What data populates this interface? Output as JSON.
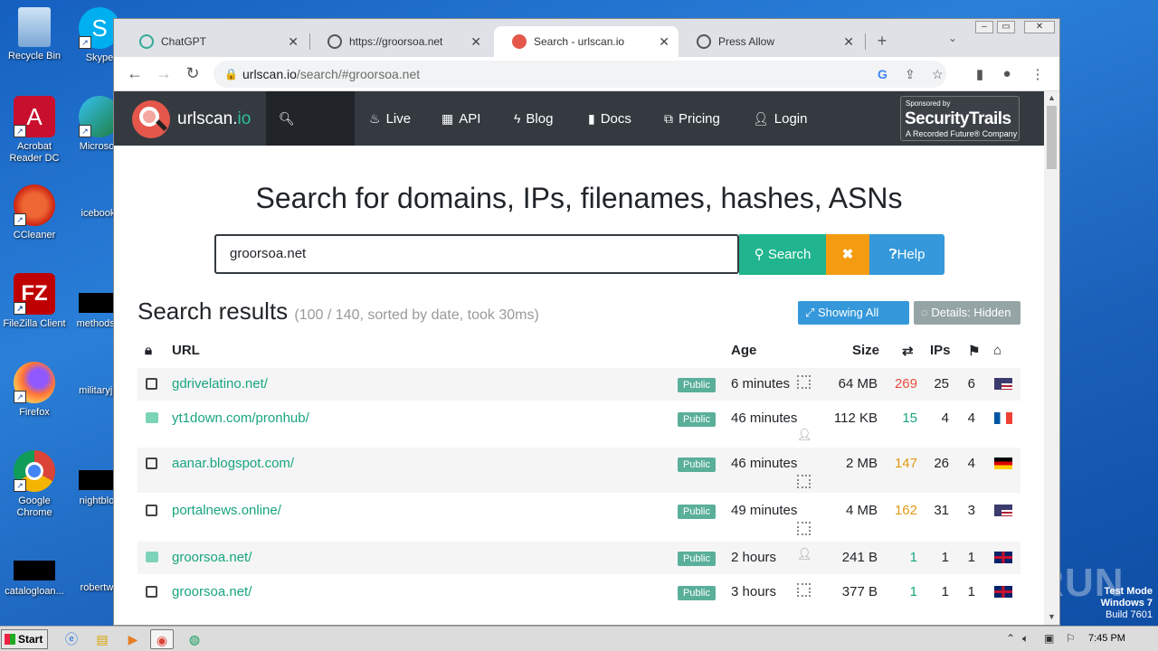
{
  "desktop": {
    "icons": [
      {
        "label": "Recycle Bin"
      },
      {
        "label": "Acrobat Reader DC"
      },
      {
        "label": "CCleaner"
      },
      {
        "label": "FileZilla Client"
      },
      {
        "label": "Firefox"
      },
      {
        "label": "Google Chrome"
      },
      {
        "label": "catalogloan..."
      },
      {
        "label": "Skype"
      },
      {
        "label": "Microsoft"
      },
      {
        "label": "icebook."
      },
      {
        "label": "methodsla"
      },
      {
        "label": "militaryjul"
      },
      {
        "label": "nightblog"
      },
      {
        "label": "robertwo"
      }
    ],
    "watermark": "ANY.RUN",
    "os_info": {
      "line1": "Test Mode",
      "line2": "Windows 7",
      "line3": "Build 7601"
    }
  },
  "browser": {
    "tabs": [
      {
        "title": "ChatGPT",
        "icon": "chatgpt-icon"
      },
      {
        "title": "https://groorsoa.net",
        "icon": "globe-icon"
      },
      {
        "title": "Search - urlscan.io",
        "icon": "urlscan-icon",
        "active": true
      },
      {
        "title": "Press Allow",
        "icon": "globe-icon"
      }
    ],
    "url_host": "urlscan.io",
    "url_path": "/search/#groorsoa.net"
  },
  "site": {
    "brand_name": "urlscan.",
    "brand_suffix": "io",
    "nav": [
      {
        "label": "Search",
        "icon": "search-icon"
      },
      {
        "label": "Live",
        "icon": "fire-icon"
      },
      {
        "label": "API",
        "icon": "qrcode-icon"
      },
      {
        "label": "Blog",
        "icon": "bolt-icon"
      },
      {
        "label": "Docs",
        "icon": "bookmark-icon"
      },
      {
        "label": "Pricing",
        "icon": "external-icon"
      },
      {
        "label": "Login",
        "icon": "user-icon"
      }
    ],
    "sponsor": {
      "small": "Sponsored by",
      "name": "SecurityTrails",
      "sub": "A Recorded Future® Company"
    }
  },
  "search": {
    "headline": "Search for domains, IPs, filenames, hashes, ASNs",
    "query": "groorsoa.net",
    "search_label": "Search",
    "clear_label": "✖",
    "help_label": "Help"
  },
  "results": {
    "title": "Search results",
    "meta": "(100 / 140, sorted by date, took 30ms)",
    "showing_all_hits": "Showing All Hits",
    "details_hidden": "Details: Hidden",
    "columns": {
      "url": "URL",
      "age": "Age",
      "size": "Size",
      "ips": "IPs"
    },
    "rows": [
      {
        "url": "gdrivelatino.net/",
        "badge": "Public",
        "age": "6 minutes",
        "size": "64 MB",
        "requests": "269",
        "req_color": "red",
        "ips": "25",
        "countries": "6",
        "flag": "us",
        "lock": false,
        "marker": "qr"
      },
      {
        "url": "yt1down.com/pronhub/",
        "badge": "Public",
        "age": "46 minutes",
        "size": "112 KB",
        "requests": "15",
        "req_color": "green",
        "ips": "4",
        "countries": "4",
        "flag": "fr",
        "lock": true,
        "marker": "user"
      },
      {
        "url": "aanar.blogspot.com/",
        "badge": "Public",
        "age": "46 minutes",
        "size": "2 MB",
        "requests": "147",
        "req_color": "orange",
        "ips": "26",
        "countries": "4",
        "flag": "de",
        "lock": false,
        "marker": "qr"
      },
      {
        "url": "portalnews.online/",
        "badge": "Public",
        "age": "49 minutes",
        "size": "4 MB",
        "requests": "162",
        "req_color": "orange",
        "ips": "31",
        "countries": "3",
        "flag": "us",
        "lock": false,
        "marker": "qr"
      },
      {
        "url": "groorsoa.net/",
        "badge": "Public",
        "age": "2 hours",
        "size": "241 B",
        "requests": "1",
        "req_color": "green",
        "ips": "1",
        "countries": "1",
        "flag": "gb",
        "lock": true,
        "marker": "user"
      },
      {
        "url": "groorsoa.net/",
        "badge": "Public",
        "age": "3 hours",
        "size": "377 B",
        "requests": "1",
        "req_color": "green",
        "ips": "1",
        "countries": "1",
        "flag": "gb",
        "lock": false,
        "marker": "qr"
      }
    ]
  },
  "taskbar": {
    "start_label": "Start",
    "clock": "7:45 PM"
  }
}
